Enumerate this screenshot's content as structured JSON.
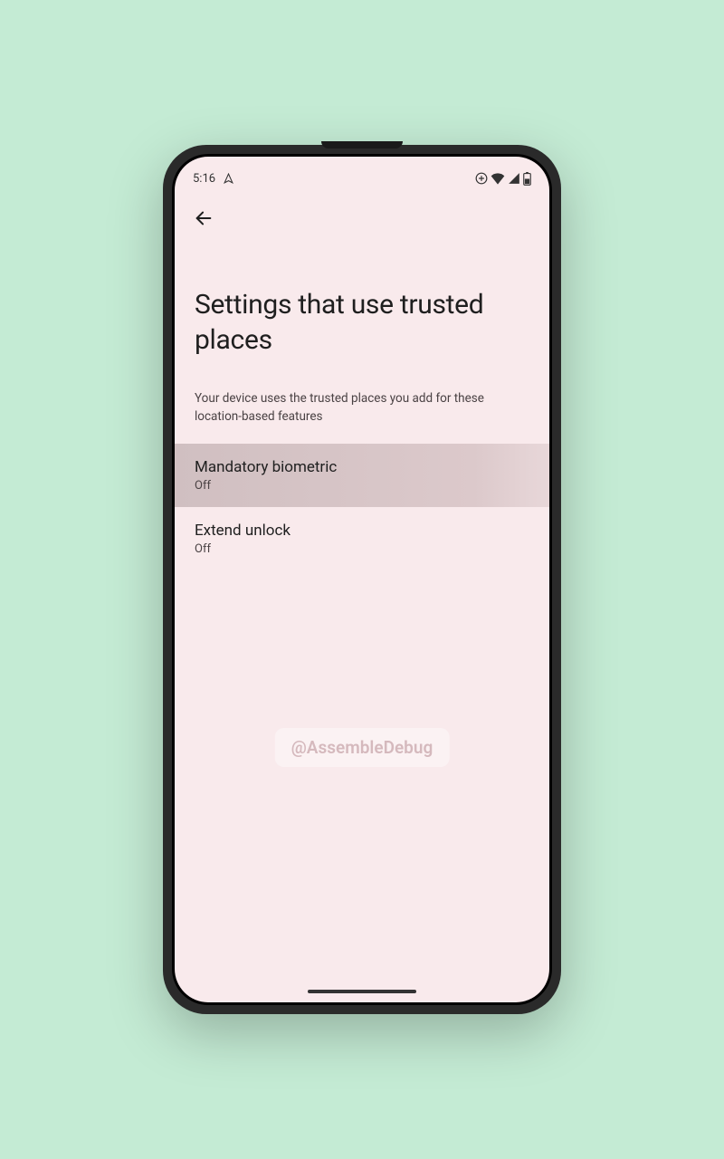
{
  "statusBar": {
    "time": "5:16"
  },
  "page": {
    "title": "Settings that use trusted places",
    "description": "Your device uses the trusted places you add for these location-based features"
  },
  "settings": [
    {
      "title": "Mandatory biometric",
      "status": "Off",
      "highlighted": true
    },
    {
      "title": "Extend unlock",
      "status": "Off",
      "highlighted": false
    }
  ],
  "watermark": "@AssembleDebug"
}
